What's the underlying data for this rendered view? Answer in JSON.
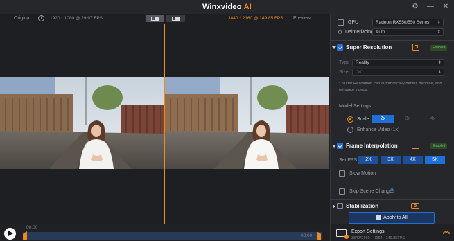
{
  "window": {
    "title_main": "Winxvideo",
    "title_accent": "AI",
    "controls": [
      "⚙",
      "—",
      "✕"
    ]
  },
  "preview": {
    "original_label": "Original",
    "original_info": "1920 * 1080 @ 29.97 FPS",
    "output_info": "3840 * 2160 @ 149.85 FPS",
    "preview_label": "Preview",
    "info_icon": "i"
  },
  "timeline": {
    "start_time": "00:00",
    "end_time": "00:00"
  },
  "panel": {
    "gpu": {
      "label": "GPU",
      "value": "Radeon RX550/550 Series"
    },
    "deinterlacing": {
      "label": "Deinterlacing",
      "value": "Auto"
    },
    "super_resolution": {
      "title": "Super Resolution",
      "badge": "Enabled",
      "type_label": "Type",
      "type_value": "Reality",
      "size_label": "Size",
      "size_value": "Off",
      "description": "* Super Resolution can automatically deblur, denoise, and enhance videos.",
      "model_settings_label": "Model Settings",
      "scale_label": "Scale",
      "scale_options": [
        "2x",
        "3x",
        "4x"
      ],
      "scale_selected": "2x",
      "enhance_label": "Enhance Video (1x)"
    },
    "frame_interpolation": {
      "title": "Frame Interpolation",
      "badge": "Enabled",
      "fps_label": "Set FPS",
      "fps_options": [
        "2X",
        "3X",
        "4X",
        "5X"
      ],
      "fps_selected": "5X",
      "slow_motion_label": "Slow Motion",
      "skip_scene_label": "Skip Scene Changes",
      "help_icon": "?"
    },
    "stabilization": {
      "title": "Stabilization"
    },
    "apply_all_label": "Apply to All",
    "export": {
      "title": "Export Settings",
      "details": "3840*2160 · H264 · 149.85FPS"
    }
  },
  "colors": {
    "accent_orange": "#f08a1c",
    "accent_blue": "#1f6fd8",
    "enabled_green": "#7cc46a",
    "panel_bg": "#26272b"
  }
}
